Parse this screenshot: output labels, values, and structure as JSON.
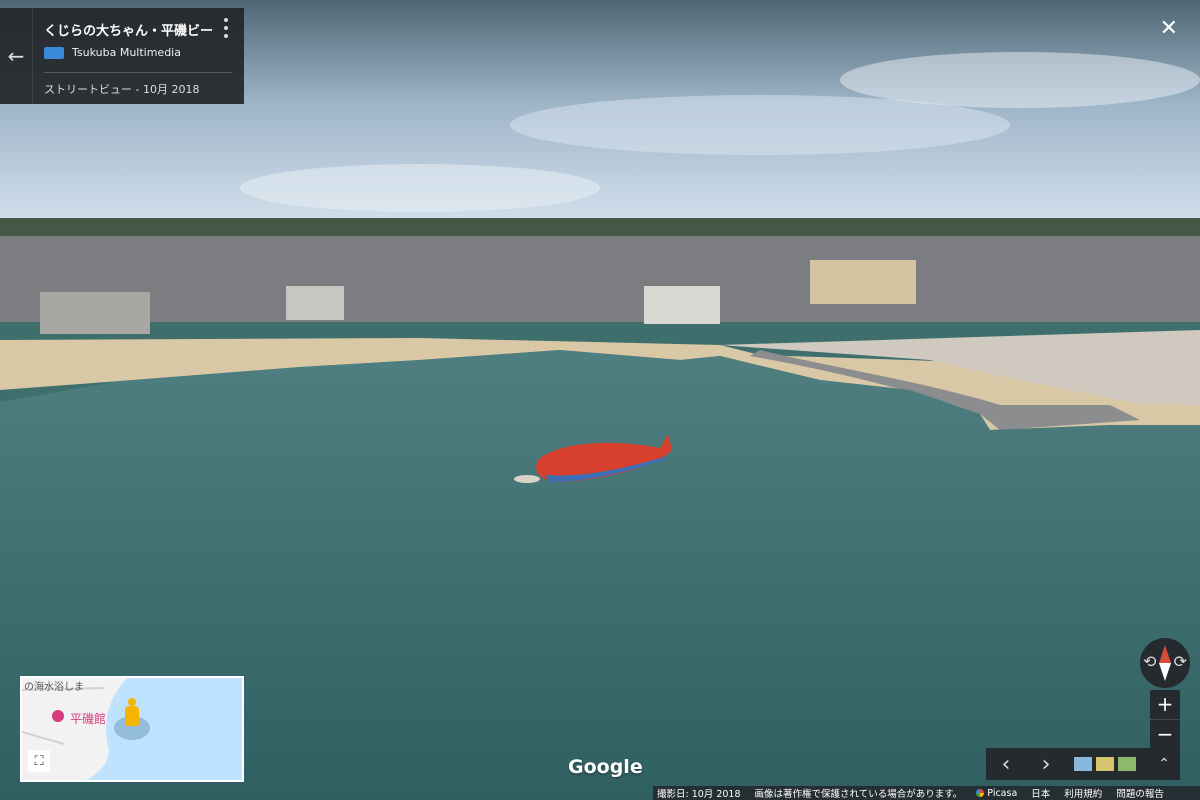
{
  "panel": {
    "title": "くじらの大ちゃん・平磯ビーチ",
    "author": "Tsukuba Multimedia",
    "date": "ストリートビュー - 10月 2018"
  },
  "icons": {
    "back": "←",
    "close": "✕",
    "menu": "more-vert-icon",
    "expand": "⛶"
  },
  "minimap": {
    "top_text": "の海水浴しま",
    "poi_label": "平磯館"
  },
  "brand": "Google",
  "controls": {
    "zoom_in": "+",
    "zoom_out": "−"
  },
  "filmstrip": {
    "prev": "‹",
    "next": "›",
    "up": "⌃"
  },
  "footer": {
    "capture": "撮影日: 10月 2018",
    "copyright": "画像は著作権で保護されている場合があります。",
    "picasa": "Picasa",
    "country": "日本",
    "terms": "利用規約",
    "report": "問題の報告"
  },
  "colors": {
    "sky_top": "#5e7485",
    "sky_bottom": "#c8d8e6",
    "sea": "#3f6f6d",
    "beach": "#d7c7a3",
    "boat": "#d6402c"
  }
}
